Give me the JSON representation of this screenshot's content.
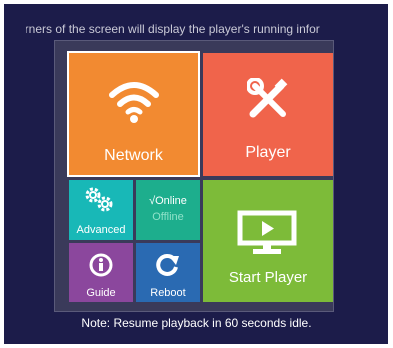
{
  "marquee": {
    "text": "corners of the screen will display the player's running infor"
  },
  "tiles": {
    "network": {
      "label": "Network",
      "icon": "wifi-icon",
      "color": "#f28a31"
    },
    "player": {
      "label": "Player",
      "icon": "tools-icon",
      "color": "#f0644b"
    },
    "advanced": {
      "label": "Advanced",
      "icon": "gears-icon",
      "color": "#18b8b7"
    },
    "status": {
      "online_label": "√Online",
      "offline_label": "Offline",
      "color": "#1dae8d"
    },
    "guide": {
      "label": "Guide",
      "icon": "info-icon",
      "color": "#8b479d"
    },
    "reboot": {
      "label": "Reboot",
      "icon": "reboot-icon",
      "color": "#2a6ab2"
    },
    "start": {
      "label": "Start Player",
      "icon": "monitor-play-icon",
      "color": "#7dbb39"
    }
  },
  "note": {
    "text": "Note: Resume playback in 60 seconds idle."
  }
}
